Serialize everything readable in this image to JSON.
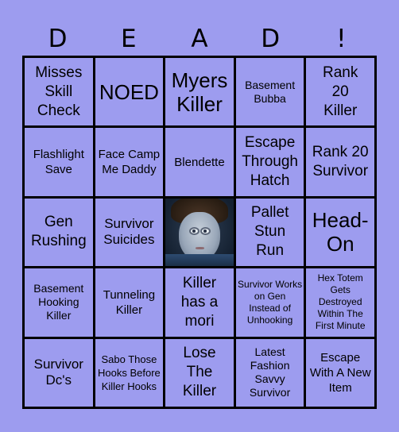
{
  "header": {
    "letters": [
      "D",
      "E",
      "A",
      "D",
      "!"
    ]
  },
  "colors": {
    "background": "#9d9cef",
    "cell": "#9d9cef",
    "grid_lines": "#000000"
  },
  "cells": [
    {
      "text": "Misses Skill Check"
    },
    {
      "text": "NOED"
    },
    {
      "text": "Myers Killer"
    },
    {
      "text": "Basement Bubba"
    },
    {
      "text": "Rank 20 Killer"
    },
    {
      "text": "Flashlight Save"
    },
    {
      "text": "Face Camp Me Daddy"
    },
    {
      "text": "Blendette"
    },
    {
      "text": "Escape Through Hatch"
    },
    {
      "text": "Rank 20 Survivor"
    },
    {
      "text": "Gen Rushing"
    },
    {
      "text": "Survivor Suicides"
    },
    {
      "text": "",
      "image": "free-space-portrait"
    },
    {
      "text": "Pallet Stun Run"
    },
    {
      "text": "Head-On"
    },
    {
      "text": "Basement Hooking Killer"
    },
    {
      "text": "Tunneling Killer"
    },
    {
      "text": "Killer has a mori"
    },
    {
      "text": "Survivor Works on Gen Instead of Unhooking"
    },
    {
      "text": "Hex Totem Gets Destroyed Within The First Minute"
    },
    {
      "text": "Survivor Dc's"
    },
    {
      "text": "Sabo Those Hooks Before Killer Hooks"
    },
    {
      "text": "Lose The Killer"
    },
    {
      "text": "Latest Fashion Savvy Survivor"
    },
    {
      "text": "Escape With A New Item"
    }
  ]
}
